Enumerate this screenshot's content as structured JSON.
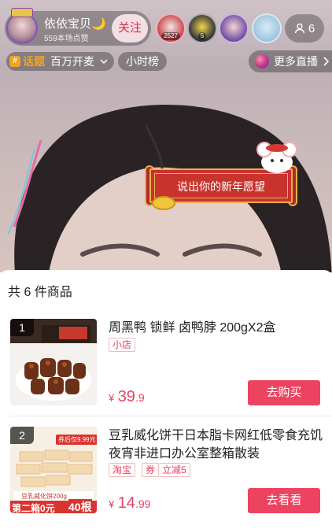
{
  "anchor": {
    "name": "依依宝贝🌙",
    "likes": "559本场点赞",
    "follow_label": "关注"
  },
  "viewers": [
    {
      "tag": "2527",
      "color": "#c9434c"
    },
    {
      "tag": "5",
      "color": "#2c2f3a"
    },
    {
      "tag": "",
      "color": "#6d4aa6"
    },
    {
      "tag": "",
      "color": "#9ec3de"
    }
  ],
  "viewer_count": "6",
  "topic": {
    "tag": "话题",
    "name": "百万开麦"
  },
  "hour_rank_label": "小时榜",
  "more_live_label": "更多直播",
  "wish_text": "说出你的新年愿望",
  "panel": {
    "title": "共 6 件商品",
    "products": [
      {
        "index": "1",
        "title": "周黑鸭 锁鲜 卤鸭脖 200gX2盒",
        "tags": [
          "小店"
        ],
        "price_currency": "¥",
        "price_int": "39",
        "price_dec": ".9",
        "button": "去购买"
      },
      {
        "index": "2",
        "title": "豆乳威化饼干日本脂卡网红低零食充饥夜宵非进口办公室整箱散装",
        "tags": [
          "淘宝",
          "券",
          "立减5"
        ],
        "price_currency": "¥",
        "price_int": "14",
        "price_dec": ".99",
        "button": "去看看",
        "thumb_text": {
          "top": "券后仅9.99元",
          "brand": "豆乳威化饼200g",
          "promo": "第二箱0元",
          "count": "40根"
        }
      }
    ]
  },
  "colors": {
    "accent": "#ec4360",
    "topic": "#f0a325"
  }
}
